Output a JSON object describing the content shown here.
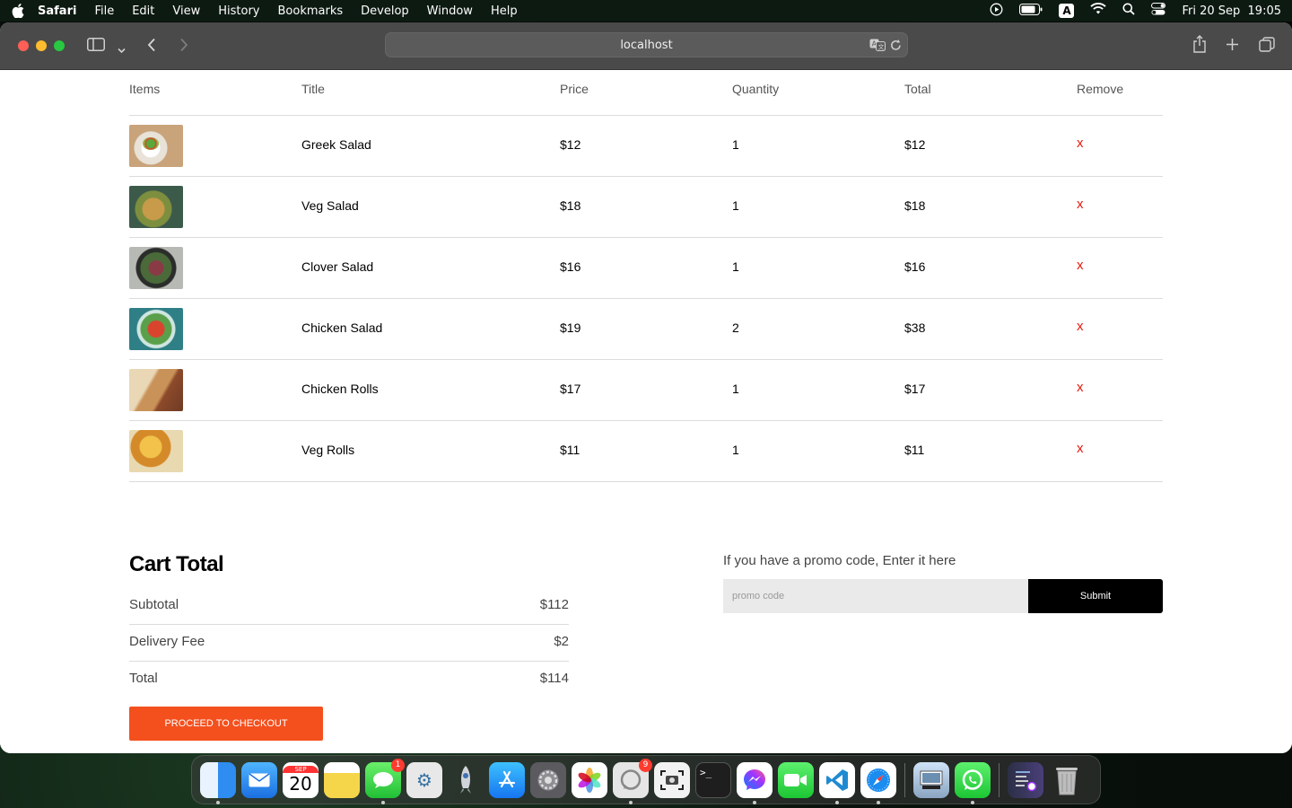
{
  "menubar": {
    "app": "Safari",
    "items": [
      "File",
      "Edit",
      "View",
      "History",
      "Bookmarks",
      "Develop",
      "Window",
      "Help"
    ],
    "clock": "Fri 20 Sep  19:05",
    "keyboard": "A"
  },
  "browser": {
    "url": "localhost"
  },
  "table": {
    "headers": [
      "Items",
      "Title",
      "Price",
      "Quantity",
      "Total",
      "Remove"
    ],
    "rows": [
      {
        "title": "Greek Salad",
        "price": "$12",
        "quantity": "1",
        "total": "$12",
        "remove": "x"
      },
      {
        "title": "Veg Salad",
        "price": "$18",
        "quantity": "1",
        "total": "$18",
        "remove": "x"
      },
      {
        "title": "Clover Salad",
        "price": "$16",
        "quantity": "1",
        "total": "$16",
        "remove": "x"
      },
      {
        "title": "Chicken Salad",
        "price": "$19",
        "quantity": "2",
        "total": "$38",
        "remove": "x"
      },
      {
        "title": "Chicken Rolls",
        "price": "$17",
        "quantity": "1",
        "total": "$17",
        "remove": "x"
      },
      {
        "title": "Veg Rolls",
        "price": "$11",
        "quantity": "1",
        "total": "$11",
        "remove": "x"
      }
    ]
  },
  "cart_total": {
    "title": "Cart Total",
    "subtotal_label": "Subtotal",
    "subtotal_value": "$112",
    "delivery_label": "Delivery Fee",
    "delivery_value": "$2",
    "total_label": "Total",
    "total_value": "$114",
    "checkout_label": "PROCEED TO CHECKOUT"
  },
  "promo": {
    "label": "If you have a promo code, Enter it here",
    "placeholder": "promo code",
    "submit_label": "Submit"
  },
  "dock": {
    "calendar_month": "SEP",
    "calendar_day": "20",
    "messages_badge": "1",
    "whatsapp_beta_badge": "9"
  },
  "colors": {
    "accent": "#f4501e",
    "remove": "#e8180c"
  }
}
